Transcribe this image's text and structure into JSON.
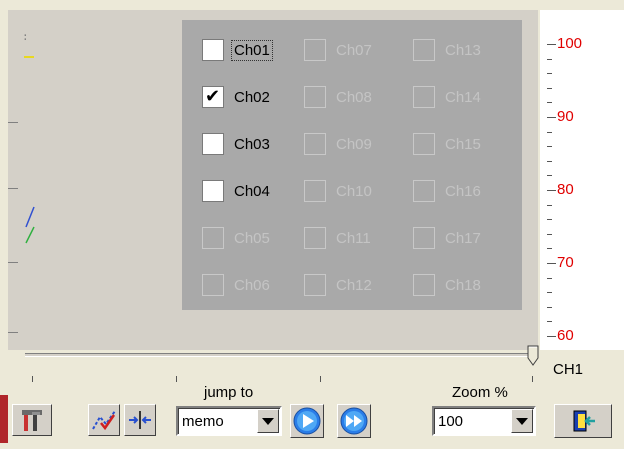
{
  "channels": [
    {
      "label": "Ch01",
      "checked": false,
      "enabled": true,
      "focused": true
    },
    {
      "label": "Ch02",
      "checked": true,
      "enabled": true,
      "focused": false
    },
    {
      "label": "Ch03",
      "checked": false,
      "enabled": true,
      "focused": false
    },
    {
      "label": "Ch04",
      "checked": false,
      "enabled": true,
      "focused": false
    },
    {
      "label": "Ch05",
      "checked": false,
      "enabled": false,
      "focused": false
    },
    {
      "label": "Ch06",
      "checked": false,
      "enabled": false,
      "focused": false
    },
    {
      "label": "Ch07",
      "checked": false,
      "enabled": false,
      "focused": false
    },
    {
      "label": "Ch08",
      "checked": false,
      "enabled": false,
      "focused": false
    },
    {
      "label": "Ch09",
      "checked": false,
      "enabled": false,
      "focused": false
    },
    {
      "label": "Ch10",
      "checked": false,
      "enabled": false,
      "focused": false
    },
    {
      "label": "Ch11",
      "checked": false,
      "enabled": false,
      "focused": false
    },
    {
      "label": "Ch12",
      "checked": false,
      "enabled": false,
      "focused": false
    },
    {
      "label": "Ch13",
      "checked": false,
      "enabled": false,
      "focused": false
    },
    {
      "label": "Ch14",
      "checked": false,
      "enabled": false,
      "focused": false
    },
    {
      "label": "Ch15",
      "checked": false,
      "enabled": false,
      "focused": false
    },
    {
      "label": "Ch16",
      "checked": false,
      "enabled": false,
      "focused": false
    },
    {
      "label": "Ch17",
      "checked": false,
      "enabled": false,
      "focused": false
    },
    {
      "label": "Ch18",
      "checked": false,
      "enabled": false,
      "focused": false
    }
  ],
  "scale": {
    "labels": [
      "100",
      "90",
      "80",
      "70",
      "60"
    ],
    "color": "#e00000"
  },
  "slider": {
    "position": 1.0,
    "channel_label": "CH1"
  },
  "toolbar": {
    "jump_to_label": "jump to",
    "jump_to_value": "memo",
    "zoom_label": "Zoom %",
    "zoom_value": "100",
    "icons": {
      "settings": "tools-icon",
      "trace": "trace-check-icon",
      "fit": "compress-arrows-icon",
      "play": "play-icon",
      "fast_forward": "fast-forward-icon",
      "exit": "exit-door-icon"
    }
  },
  "colors": {
    "panel_bg": "#a9a9a9",
    "app_bg": "#ece9d8",
    "trace_bg": "#d4d0c8",
    "disabled_text": "#c4c4c4"
  }
}
